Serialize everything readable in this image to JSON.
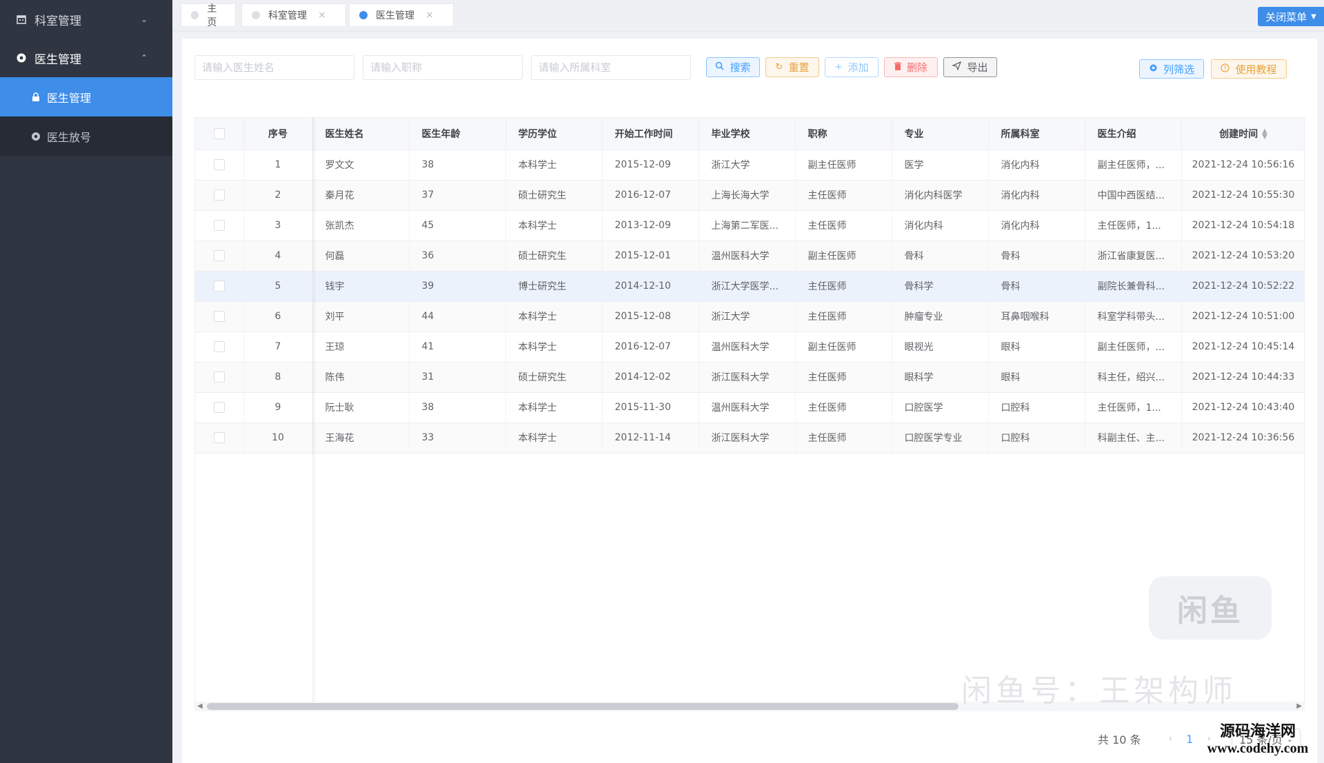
{
  "sidebar": {
    "groups": [
      {
        "label": "科室管理",
        "open": false
      },
      {
        "label": "医生管理",
        "open": true
      }
    ],
    "items": [
      {
        "label": "医生管理",
        "active": true
      },
      {
        "label": "医生放号",
        "active": false
      }
    ]
  },
  "tabs": [
    {
      "label": "主页",
      "closable": false,
      "active": false
    },
    {
      "label": "科室管理",
      "closable": true,
      "active": false
    },
    {
      "label": "医生管理",
      "closable": true,
      "active": true
    }
  ],
  "tab_close_glyph": "×",
  "close_menu_label": "关闭菜单",
  "search": {
    "name_placeholder": "请输入医生姓名",
    "title_placeholder": "请输入职称",
    "dept_placeholder": "请输入所属科室"
  },
  "toolbar": {
    "search_label": "搜索",
    "reset_label": "重置",
    "add_label": "添加",
    "delete_label": "删除",
    "export_label": "导出",
    "columns_label": "列筛选",
    "tutorial_label": "使用教程"
  },
  "table": {
    "columns": [
      "序号",
      "医生姓名",
      "医生年龄",
      "学历学位",
      "开始工作时间",
      "毕业学校",
      "职称",
      "专业",
      "所属科室",
      "医生介绍",
      "创建时间"
    ],
    "rows": [
      [
        "1",
        "罗文文",
        "38",
        "本科学士",
        "2015-12-09",
        "浙江大学",
        "副主任医师",
        "医学",
        "消化内科",
        "副主任医师，...",
        "2021-12-24 10:56:16"
      ],
      [
        "2",
        "秦月花",
        "37",
        "硕士研究生",
        "2016-12-07",
        "上海长海大学",
        "主任医师",
        "消化内科医学",
        "消化内科",
        "中国中西医结...",
        "2021-12-24 10:55:30"
      ],
      [
        "3",
        "张凯杰",
        "45",
        "本科学士",
        "2013-12-09",
        "上海第二军医...",
        "主任医师",
        "消化内科",
        "消化内科",
        "主任医师，1...",
        "2021-12-24 10:54:18"
      ],
      [
        "4",
        "何磊",
        "36",
        "硕士研究生",
        "2015-12-01",
        "温州医科大学",
        "副主任医师",
        "骨科",
        "骨科",
        "浙江省康复医...",
        "2021-12-24 10:53:20"
      ],
      [
        "5",
        "钱宇",
        "39",
        "博士研究生",
        "2014-12-10",
        "浙江大学医学...",
        "主任医师",
        "骨科学",
        "骨科",
        "副院长兼骨科...",
        "2021-12-24 10:52:22"
      ],
      [
        "6",
        "刘平",
        "44",
        "本科学士",
        "2015-12-08",
        "浙江大学",
        "主任医师",
        "肿瘤专业",
        "耳鼻咽喉科",
        "科室学科带头...",
        "2021-12-24 10:51:00"
      ],
      [
        "7",
        "王琼",
        "41",
        "本科学士",
        "2016-12-07",
        "温州医科大学",
        "副主任医师",
        "眼视光",
        "眼科",
        "副主任医师，...",
        "2021-12-24 10:45:14"
      ],
      [
        "8",
        "陈伟",
        "31",
        "硕士研究生",
        "2014-12-02",
        "浙江医科大学",
        "主任医师",
        "眼科学",
        "眼科",
        "科主任，绍兴...",
        "2021-12-24 10:44:33"
      ],
      [
        "9",
        "阮士耿",
        "38",
        "本科学士",
        "2015-11-30",
        "温州医科大学",
        "主任医师",
        "口腔医学",
        "口腔科",
        "主任医师，1...",
        "2021-12-24 10:43:40"
      ],
      [
        "10",
        "王海花",
        "33",
        "本科学士",
        "2012-11-14",
        "浙江医科大学",
        "主任医师",
        "口腔医学专业",
        "口腔科",
        "科副主任、主...",
        "2021-12-24 10:36:56"
      ]
    ]
  },
  "pagination": {
    "total_label": "共 10 条",
    "current_page": "1",
    "page_size_label": "15 条/页",
    "prev_glyph": "‹",
    "next_glyph": "›"
  },
  "watermarks": {
    "logo_text": "闲鱼",
    "id_text": "闲鱼号：王架构师",
    "site_name": "源码海洋网",
    "site_url": "www.codehy.com"
  },
  "colors": {
    "sidebar_bg": "#2f3541",
    "accent": "#3d8de9",
    "primary": "#409eff",
    "warning": "#e6a23c",
    "danger": "#f56c6c"
  },
  "icons": {
    "group_1": "calendar-icon",
    "group_2": "gear-icon",
    "item_1": "lock-icon",
    "item_2": "gear-icon",
    "search": "search-icon",
    "reset": "refresh-icon",
    "add": "plus-icon",
    "delete": "trash-icon",
    "export": "send-icon",
    "columns": "gear-icon",
    "tutorial": "question-icon"
  }
}
